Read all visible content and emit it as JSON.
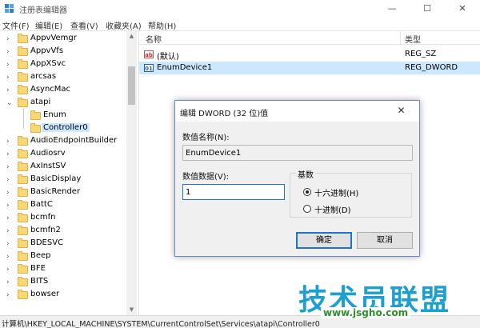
{
  "window": {
    "title": "注册表编辑器",
    "controls": {
      "minimize": "—",
      "maximize": "☐",
      "close": "✕"
    }
  },
  "menu": [
    "文件(F)",
    "编辑(E)",
    "查看(V)",
    "收藏夹(A)",
    "帮助(H)"
  ],
  "tree": {
    "items": [
      {
        "label": "AppvVemgr",
        "expander": "›"
      },
      {
        "label": "AppvVfs",
        "expander": "›"
      },
      {
        "label": "AppXSvc",
        "expander": "›"
      },
      {
        "label": "arcsas",
        "expander": "›"
      },
      {
        "label": "AsyncMac",
        "expander": "›"
      },
      {
        "label": "atapi",
        "expander": "⌄"
      },
      {
        "label": "Enum",
        "expander": ""
      },
      {
        "label": "Controller0",
        "expander": ""
      },
      {
        "label": "AudioEndpointBuilder",
        "expander": "›"
      },
      {
        "label": "Audiosrv",
        "expander": "›"
      },
      {
        "label": "AxInstSV",
        "expander": "›"
      },
      {
        "label": "BasicDisplay",
        "expander": "›"
      },
      {
        "label": "BasicRender",
        "expander": "›"
      },
      {
        "label": "BattC",
        "expander": "›"
      },
      {
        "label": "bcmfn",
        "expander": "›"
      },
      {
        "label": "bcmfn2",
        "expander": "›"
      },
      {
        "label": "BDESVC",
        "expander": "›"
      },
      {
        "label": "Beep",
        "expander": "›"
      },
      {
        "label": "BFE",
        "expander": "›"
      },
      {
        "label": "BITS",
        "expander": "›"
      },
      {
        "label": "bowser",
        "expander": "›"
      }
    ],
    "scroll_up": "▲",
    "scroll_down": "▼"
  },
  "list": {
    "headers": {
      "name": "名称",
      "type": "类型"
    },
    "rows": [
      {
        "icon": "ab",
        "name": "(默认)",
        "type": "REG_SZ"
      },
      {
        "icon": "01",
        "name": "EnumDevice1",
        "type": "REG_DWORD"
      }
    ]
  },
  "dialog": {
    "title": "编辑 DWORD (32 位)值",
    "close": "✕",
    "name_label": "数值名称(N):",
    "name_value": "EnumDevice1",
    "data_label": "数值数据(V):",
    "data_value": "1",
    "base_title": "基数",
    "hex_label": "十六进制(H)",
    "dec_label": "十进制(D)",
    "selected_base": "hex",
    "ok_label": "确定",
    "cancel_label": "取消"
  },
  "status": {
    "path": "计算机\\HKEY_LOCAL_MACHINE\\SYSTEM\\CurrentControlSet\\Services\\atapi\\Controller0"
  },
  "watermark": {
    "main": "技术员联盟",
    "url": "www.jsgho.com"
  }
}
